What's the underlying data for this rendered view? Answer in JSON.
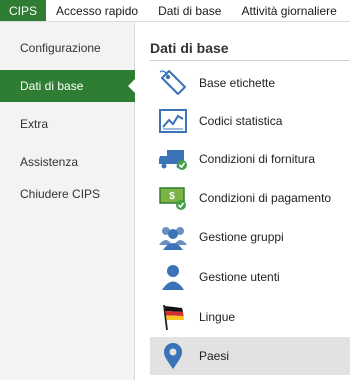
{
  "topbar": {
    "tabs": [
      {
        "label": "CIPS",
        "active": true
      },
      {
        "label": "Accesso rapido"
      },
      {
        "label": "Dati di base"
      },
      {
        "label": "Attività giornaliere"
      }
    ]
  },
  "sidebar": {
    "items": [
      {
        "label": "Configurazione"
      },
      {
        "label": "Dati di base",
        "active": true
      },
      {
        "label": "Extra"
      },
      {
        "label": "Assistenza"
      },
      {
        "label": "Chiudere CIPS"
      }
    ]
  },
  "main": {
    "heading": "Dati di base",
    "entries": [
      {
        "label": "Base etichette",
        "icon": "tag-icon"
      },
      {
        "label": "Codici statistica",
        "icon": "statistics-chart-icon"
      },
      {
        "label": "Condizioni di fornitura",
        "icon": "delivery-truck-icon"
      },
      {
        "label": "Condizioni di pagamento",
        "icon": "payment-money-icon"
      },
      {
        "label": "Gestione gruppi",
        "icon": "user-group-icon"
      },
      {
        "label": "Gestione utenti",
        "icon": "user-icon"
      },
      {
        "label": "Lingue",
        "icon": "language-flag-icon"
      },
      {
        "label": "Paesi",
        "icon": "location-pin-icon",
        "selected": true
      }
    ]
  },
  "colors": {
    "accent": "#2e7d32",
    "icon_blue": "#3b73b9",
    "selected_bg": "#e2e2e2"
  }
}
